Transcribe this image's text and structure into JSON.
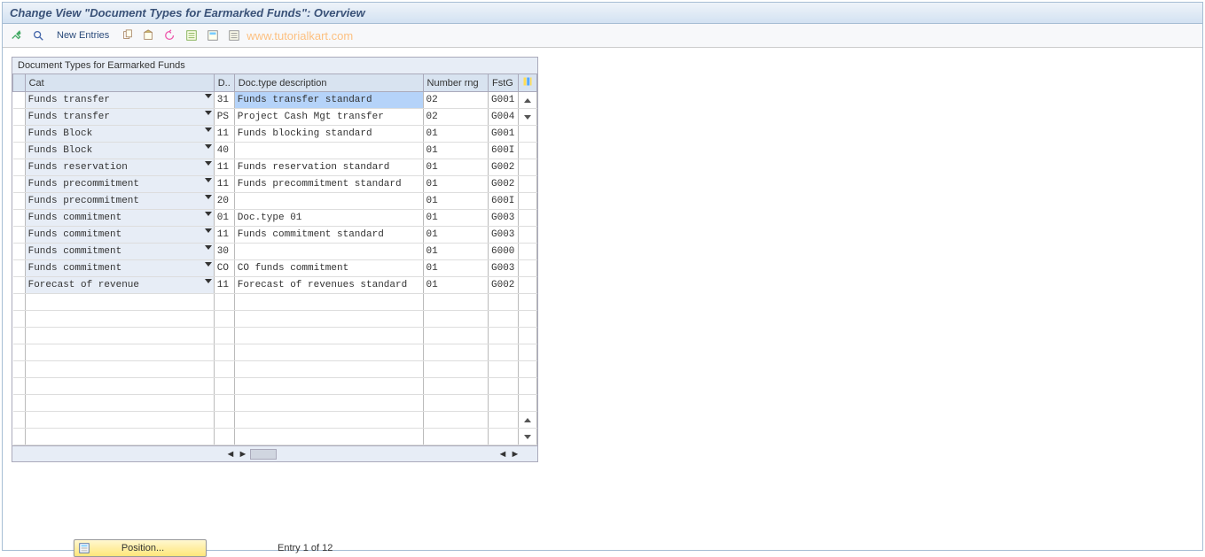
{
  "title": "Change View \"Document Types for Earmarked Funds\": Overview",
  "toolbar": {
    "new_entries": "New Entries"
  },
  "watermark": "www.tutorialkart.com",
  "table": {
    "title": "Document Types for Earmarked Funds",
    "columns": {
      "cat": "Cat",
      "doctype": "D..",
      "desc": "Doc.type description",
      "nrng": "Number rng",
      "fstg": "FstG"
    },
    "rows": [
      {
        "cat": "Funds transfer",
        "dt": "31",
        "desc": "Funds transfer standard",
        "nr": "02",
        "fg": "G001",
        "hl": true
      },
      {
        "cat": "Funds transfer",
        "dt": "PS",
        "desc": "Project Cash Mgt transfer",
        "nr": "02",
        "fg": "G004"
      },
      {
        "cat": "Funds Block",
        "dt": "11",
        "desc": "Funds blocking standard",
        "nr": "01",
        "fg": "G001"
      },
      {
        "cat": "Funds Block",
        "dt": "40",
        "desc": "",
        "nr": "01",
        "fg": "600I"
      },
      {
        "cat": "Funds reservation",
        "dt": "11",
        "desc": "Funds reservation standard",
        "nr": "01",
        "fg": "G002"
      },
      {
        "cat": "Funds precommitment",
        "dt": "11",
        "desc": "Funds precommitment standard",
        "nr": "01",
        "fg": "G002"
      },
      {
        "cat": "Funds precommitment",
        "dt": "20",
        "desc": "",
        "nr": "01",
        "fg": "600I"
      },
      {
        "cat": "Funds commitment",
        "dt": "01",
        "desc": "Doc.type 01",
        "nr": "01",
        "fg": "G003"
      },
      {
        "cat": "Funds commitment",
        "dt": "11",
        "desc": "Funds commitment standard",
        "nr": "01",
        "fg": "G003"
      },
      {
        "cat": "Funds commitment",
        "dt": "30",
        "desc": "",
        "nr": "01",
        "fg": "6000"
      },
      {
        "cat": "Funds commitment",
        "dt": "CO",
        "desc": "CO funds commitment",
        "nr": "01",
        "fg": "G003"
      },
      {
        "cat": "Forecast of revenue",
        "dt": "11",
        "desc": "Forecast of revenues standard",
        "nr": "01",
        "fg": "G002"
      },
      {
        "cat": "",
        "dt": "",
        "desc": "",
        "nr": "",
        "fg": "",
        "empty": true
      },
      {
        "cat": "",
        "dt": "",
        "desc": "",
        "nr": "",
        "fg": "",
        "empty": true
      },
      {
        "cat": "",
        "dt": "",
        "desc": "",
        "nr": "",
        "fg": "",
        "empty": true
      },
      {
        "cat": "",
        "dt": "",
        "desc": "",
        "nr": "",
        "fg": "",
        "empty": true
      },
      {
        "cat": "",
        "dt": "",
        "desc": "",
        "nr": "",
        "fg": "",
        "empty": true
      },
      {
        "cat": "",
        "dt": "",
        "desc": "",
        "nr": "",
        "fg": "",
        "empty": true
      },
      {
        "cat": "",
        "dt": "",
        "desc": "",
        "nr": "",
        "fg": "",
        "empty": true
      },
      {
        "cat": "",
        "dt": "",
        "desc": "",
        "nr": "",
        "fg": "",
        "empty": true
      },
      {
        "cat": "",
        "dt": "",
        "desc": "",
        "nr": "",
        "fg": "",
        "empty": true
      }
    ]
  },
  "footer": {
    "position": "Position...",
    "entry": "Entry 1 of 12"
  }
}
